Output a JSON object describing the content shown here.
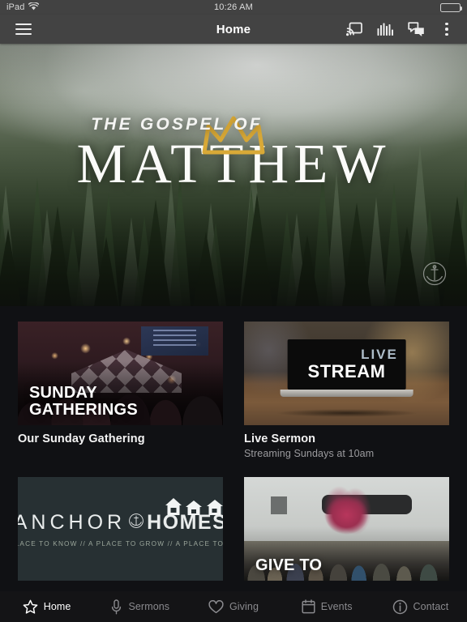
{
  "status_bar": {
    "device": "iPad",
    "wifi_icon": "wifi-icon",
    "time": "10:26 AM",
    "battery_icon": "battery-full-icon"
  },
  "nav_bar": {
    "menu_icon": "hamburger-menu-icon",
    "title": "Home",
    "actions": [
      {
        "icon": "chromecast-icon",
        "name": "cast-button"
      },
      {
        "icon": "equalizer-icon",
        "name": "audio-equalizer-button"
      },
      {
        "icon": "chat-bubbles-icon",
        "name": "messages-button"
      },
      {
        "icon": "overflow-dots-icon",
        "name": "overflow-menu-button"
      }
    ]
  },
  "hero": {
    "eyebrow": "THE GOSPEL OF",
    "title": "MATTHEW",
    "crown_icon": "crown-icon",
    "watermark_icon": "anchor-logo-icon"
  },
  "cards": [
    {
      "overlay_line1": "SUNDAY",
      "overlay_line2": "GATHERINGS",
      "title": "Our Sunday Gathering",
      "subtitle": ""
    },
    {
      "overlay_live": "LIVE",
      "overlay_stream": "STREAM",
      "title": "Live Sermon",
      "subtitle": "Streaming Sundays at 10am"
    },
    {
      "logo_word1": "ANCHOR",
      "logo_word2": "HOMES",
      "tagline": "A PLACE TO KNOW  //  A PLACE TO GROW  //  A PLACE TO GO",
      "title": "",
      "subtitle": ""
    },
    {
      "overlay_line1": "GIVE TO",
      "title": "",
      "subtitle": ""
    }
  ],
  "tab_bar": {
    "items": [
      {
        "label": "Home",
        "icon": "star-icon",
        "active": true
      },
      {
        "label": "Sermons",
        "icon": "microphone-icon",
        "active": false
      },
      {
        "label": "Giving",
        "icon": "heart-icon",
        "active": false
      },
      {
        "label": "Events",
        "icon": "calendar-icon",
        "active": false
      },
      {
        "label": "Contact",
        "icon": "info-circle-icon",
        "active": false
      }
    ]
  },
  "colors": {
    "nav_bar": "#434343",
    "status_bar": "#424242",
    "page_background": "#101114",
    "accent_gold": "#d9a937",
    "tab_active": "#ffffff",
    "tab_inactive": "#8a8a8e"
  }
}
